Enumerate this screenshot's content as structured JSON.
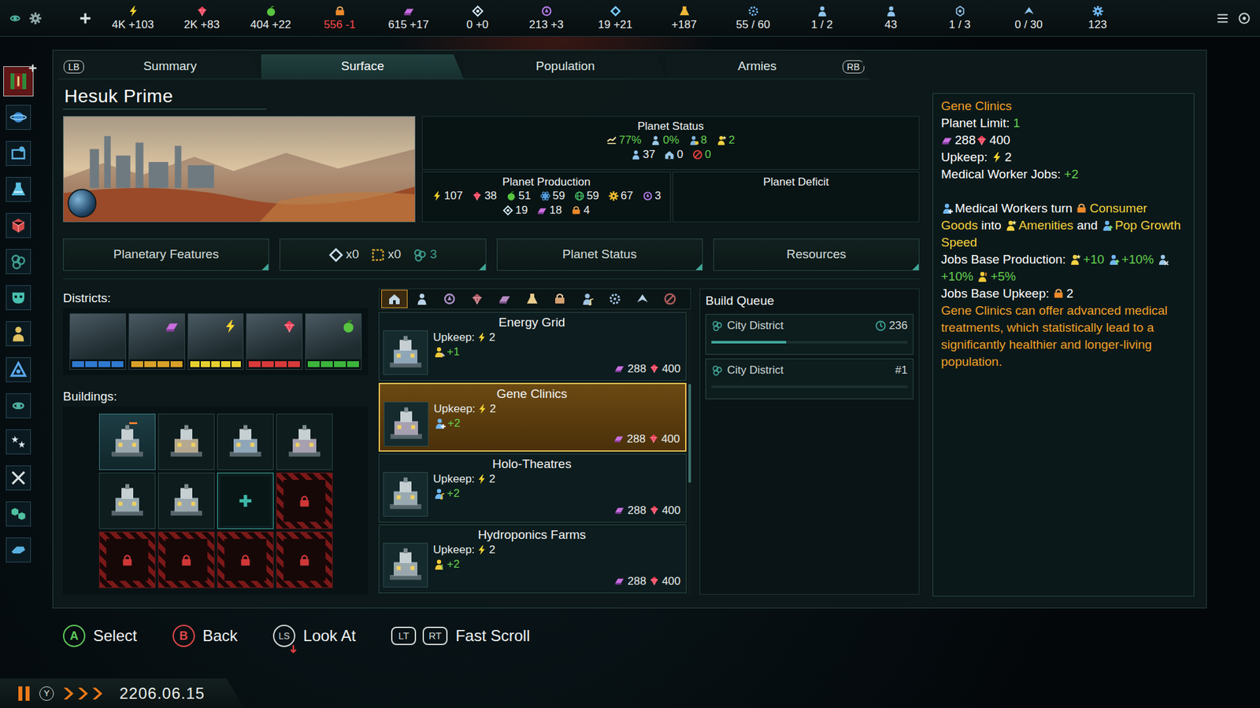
{
  "top_bar": {
    "resources": [
      {
        "kind": "energy",
        "value": "4K +103",
        "deficit": false
      },
      {
        "kind": "minerals",
        "value": "2K +83",
        "deficit": false
      },
      {
        "kind": "food",
        "value": "404 +22",
        "deficit": false
      },
      {
        "kind": "consumer_goods",
        "value": "556 -1",
        "deficit": true
      },
      {
        "kind": "alloys",
        "value": "615 +17",
        "deficit": false
      },
      {
        "kind": "influence",
        "value": "0 +0",
        "deficit": false
      },
      {
        "kind": "unity",
        "value": "213 +3",
        "deficit": false
      },
      {
        "kind": "exotic",
        "value": "19 +21",
        "deficit": false
      },
      {
        "kind": "research",
        "value": "+187",
        "deficit": false
      },
      {
        "kind": "admin",
        "value": "55 / 60",
        "deficit": false
      },
      {
        "kind": "envoy",
        "value": "1 / 2",
        "deficit": false
      },
      {
        "kind": "pop",
        "value": "43",
        "deficit": false
      },
      {
        "kind": "starbase",
        "value": "1 / 3",
        "deficit": false
      },
      {
        "kind": "fleet",
        "value": "0 / 30",
        "deficit": false
      },
      {
        "kind": "capacity",
        "value": "123",
        "deficit": false
      }
    ]
  },
  "sidebar": {
    "items": [
      {
        "selected": true
      },
      {
        "selected": false
      },
      {
        "selected": false
      },
      {
        "selected": false
      },
      {
        "selected": false
      },
      {
        "selected": false
      },
      {
        "selected": false
      },
      {
        "selected": false
      },
      {
        "selected": false
      },
      {
        "selected": false
      },
      {
        "selected": false
      },
      {
        "selected": false
      },
      {
        "selected": false
      },
      {
        "selected": false
      }
    ]
  },
  "tabs": {
    "prev_key": "LB",
    "next_key": "RB",
    "items": [
      {
        "label": "Summary",
        "selected": false
      },
      {
        "label": "Surface",
        "selected": true
      },
      {
        "label": "Population",
        "selected": false
      },
      {
        "label": "Armies",
        "selected": false
      }
    ]
  },
  "planet": {
    "name": "Hesuk Prime"
  },
  "planet_status": {
    "title": "Planet Status",
    "rows": [
      [
        {
          "kind": "stability",
          "value": "77%",
          "color": "#63d24f"
        },
        {
          "kind": "unemployment",
          "value": "0%",
          "color": "#63d24f"
        },
        {
          "kind": "jobs",
          "value": "8",
          "color": "#63d24f"
        },
        {
          "kind": "amenities",
          "value": "2",
          "color": "#63d24f"
        }
      ],
      [
        {
          "kind": "pop",
          "value": "37",
          "color": "#f2f5f4"
        },
        {
          "kind": "housing",
          "value": "0",
          "color": "#f2f5f4"
        },
        {
          "kind": "crime",
          "value": "0",
          "color": "#63d24f"
        }
      ]
    ]
  },
  "planet_production": {
    "title": "Planet Production",
    "rows": [
      [
        {
          "kind": "energy",
          "value": "107"
        },
        {
          "kind": "minerals",
          "value": "38"
        },
        {
          "kind": "food",
          "value": "51"
        },
        {
          "kind": "physics",
          "value": "59"
        },
        {
          "kind": "society",
          "value": "59"
        },
        {
          "kind": "engineering",
          "value": "67"
        },
        {
          "kind": "unity",
          "value": "3"
        }
      ],
      [
        {
          "kind": "influence",
          "value": "19"
        },
        {
          "kind": "alloys",
          "value": "18"
        },
        {
          "kind": "consumer_goods",
          "value": "4"
        }
      ]
    ]
  },
  "planet_deficit": {
    "title": "Planet Deficit"
  },
  "info_buttons": {
    "features": "Planetary Features",
    "counts": [
      {
        "kind": "holding",
        "value": "x0"
      },
      {
        "kind": "hazard",
        "value": "x0"
      },
      {
        "kind": "cluster",
        "value": "3"
      }
    ],
    "status": "Planet Status",
    "resources": "Resources"
  },
  "districts": {
    "label": "Districts:",
    "items": [
      {
        "kind": "city",
        "color": "#2f7ad0",
        "segments": [
          true,
          true,
          true,
          true
        ]
      },
      {
        "kind": "industrial",
        "color": "#d8a028",
        "segments": [
          true,
          true,
          true,
          true
        ]
      },
      {
        "kind": "generator",
        "color": "#e6d030",
        "segments": [
          true,
          true,
          true,
          true,
          true
        ]
      },
      {
        "kind": "mining",
        "color": "#d83a3a",
        "segments": [
          true,
          true,
          true,
          true
        ]
      },
      {
        "kind": "agriculture",
        "color": "#3cb43c",
        "segments": [
          true,
          true,
          true,
          true
        ]
      }
    ]
  },
  "buildings": {
    "label": "Buildings:",
    "slots": [
      {
        "kind": "capital"
      },
      {
        "kind": "building"
      },
      {
        "kind": "building"
      },
      {
        "kind": "building"
      },
      {
        "kind": "building"
      },
      {
        "kind": "building"
      },
      {
        "kind": "add"
      },
      {
        "kind": "locked"
      },
      {
        "kind": "locked"
      },
      {
        "kind": "locked"
      },
      {
        "kind": "locked"
      },
      {
        "kind": "locked"
      }
    ]
  },
  "build_categories": [
    {
      "selected": true
    },
    {
      "selected": false
    },
    {
      "selected": false
    },
    {
      "selected": false
    },
    {
      "selected": false
    },
    {
      "selected": false
    },
    {
      "selected": false
    },
    {
      "selected": false
    },
    {
      "selected": false
    },
    {
      "selected": false
    },
    {
      "selected": false
    }
  ],
  "build_options": [
    {
      "name": "Energy Grid",
      "upkeep_label": "Upkeep:",
      "upkeep": "2",
      "kind": "technician",
      "jobs": "+1",
      "cost_alloys": "288",
      "cost_minerals": "400",
      "selected": false
    },
    {
      "name": "Gene Clinics",
      "upkeep_label": "Upkeep:",
      "upkeep": "2",
      "kind": "medical",
      "jobs": "+2",
      "cost_alloys": "288",
      "cost_minerals": "400",
      "selected": true
    },
    {
      "name": "Holo-Theatres",
      "upkeep_label": "Upkeep:",
      "upkeep": "2",
      "kind": "entertainer",
      "jobs": "+2",
      "cost_alloys": "288",
      "cost_minerals": "400",
      "selected": false
    },
    {
      "name": "Hydroponics Farms",
      "upkeep_label": "Upkeep:",
      "upkeep": "2",
      "kind": "farmer",
      "jobs": "+2",
      "cost_alloys": "288",
      "cost_minerals": "400",
      "selected": false
    }
  ],
  "build_queue": {
    "title": "Build Queue",
    "items": [
      {
        "name": "City District",
        "kind": "time",
        "info": "236",
        "level": 0.38
      },
      {
        "name": "City District",
        "kind": "position",
        "info": "#1",
        "level": 0
      }
    ]
  },
  "tooltip": {
    "title": "Gene Clinics",
    "stats": [
      [
        {
          "text": "Planet Limit: ",
          "color": "#ffffff"
        },
        {
          "text": "1",
          "color": "#63d24f"
        }
      ],
      [
        {
          "kind": "alloys",
          "text": "288",
          "color": "#ffffff"
        },
        {
          "kind": "minerals",
          "text": "400",
          "color": "#ffffff"
        }
      ],
      [
        {
          "text": "Upkeep: ",
          "color": "#ffffff"
        },
        {
          "kind": "energy",
          "text": "2",
          "color": "#ffffff"
        }
      ],
      [
        {
          "text": "Medical Worker Jobs: ",
          "color": "#ffffff"
        },
        {
          "text": "+2",
          "color": "#63d24f"
        }
      ]
    ],
    "effects": [
      [
        {
          "kind": "medical",
          "text": "Medical Workers turn ",
          "color": "#ffffff"
        },
        {
          "kind": "consumer_goods",
          "text": "Consumer Goods",
          "color": "#f3d33b"
        },
        {
          "text": " into ",
          "color": "#ffffff"
        },
        {
          "kind": "amenities",
          "text": "Amenities",
          "color": "#f3d33b"
        },
        {
          "text": " and ",
          "color": "#ffffff"
        },
        {
          "kind": "pop_growth",
          "text": "Pop Growth Speed",
          "color": "#f3d33b"
        }
      ],
      [
        {
          "text": "Jobs Base Production: ",
          "color": "#ffffff"
        },
        {
          "kind": "amenities",
          "text": "+10",
          "color": "#63d24f"
        },
        {
          "text": " ",
          "color": "#ffffff"
        },
        {
          "kind": "pop_growth",
          "text": "+10%",
          "color": "#63d24f"
        },
        {
          "text": " ",
          "color": "#ffffff"
        },
        {
          "kind": "habitability",
          "text": "+10%",
          "color": "#63d24f"
        },
        {
          "text": " ",
          "color": "#ffffff"
        },
        {
          "kind": "happiness",
          "text": "+5%",
          "color": "#63d24f"
        }
      ],
      [
        {
          "text": "Jobs Base Upkeep: ",
          "color": "#ffffff"
        },
        {
          "kind": "consumer_goods",
          "text": "2",
          "color": "#ffffff"
        }
      ]
    ],
    "description": "Gene Clinics can offer advanced medical treatments, which statistically lead to a significantly healthier and longer-living population."
  },
  "controls": [
    {
      "keys": [
        {
          "text": "A",
          "kind": "round",
          "color": "#5ec85a"
        }
      ],
      "label": "Select"
    },
    {
      "keys": [
        {
          "text": "B",
          "kind": "round",
          "color": "#e04848"
        }
      ],
      "label": "Back"
    },
    {
      "keys": [
        {
          "text": "LS",
          "kind": "stick",
          "color": "#d0d6d4"
        }
      ],
      "label": "Look At"
    },
    {
      "keys": [
        {
          "text": "LT",
          "kind": "trigger",
          "color": "#d0d6d4"
        },
        {
          "text": "RT",
          "kind": "trigger",
          "color": "#d0d6d4"
        }
      ],
      "label": "Fast Scroll"
    }
  ],
  "time": {
    "paused": true,
    "key": "Y",
    "speed": [
      true,
      true,
      true
    ],
    "date": "2206.06.15"
  }
}
